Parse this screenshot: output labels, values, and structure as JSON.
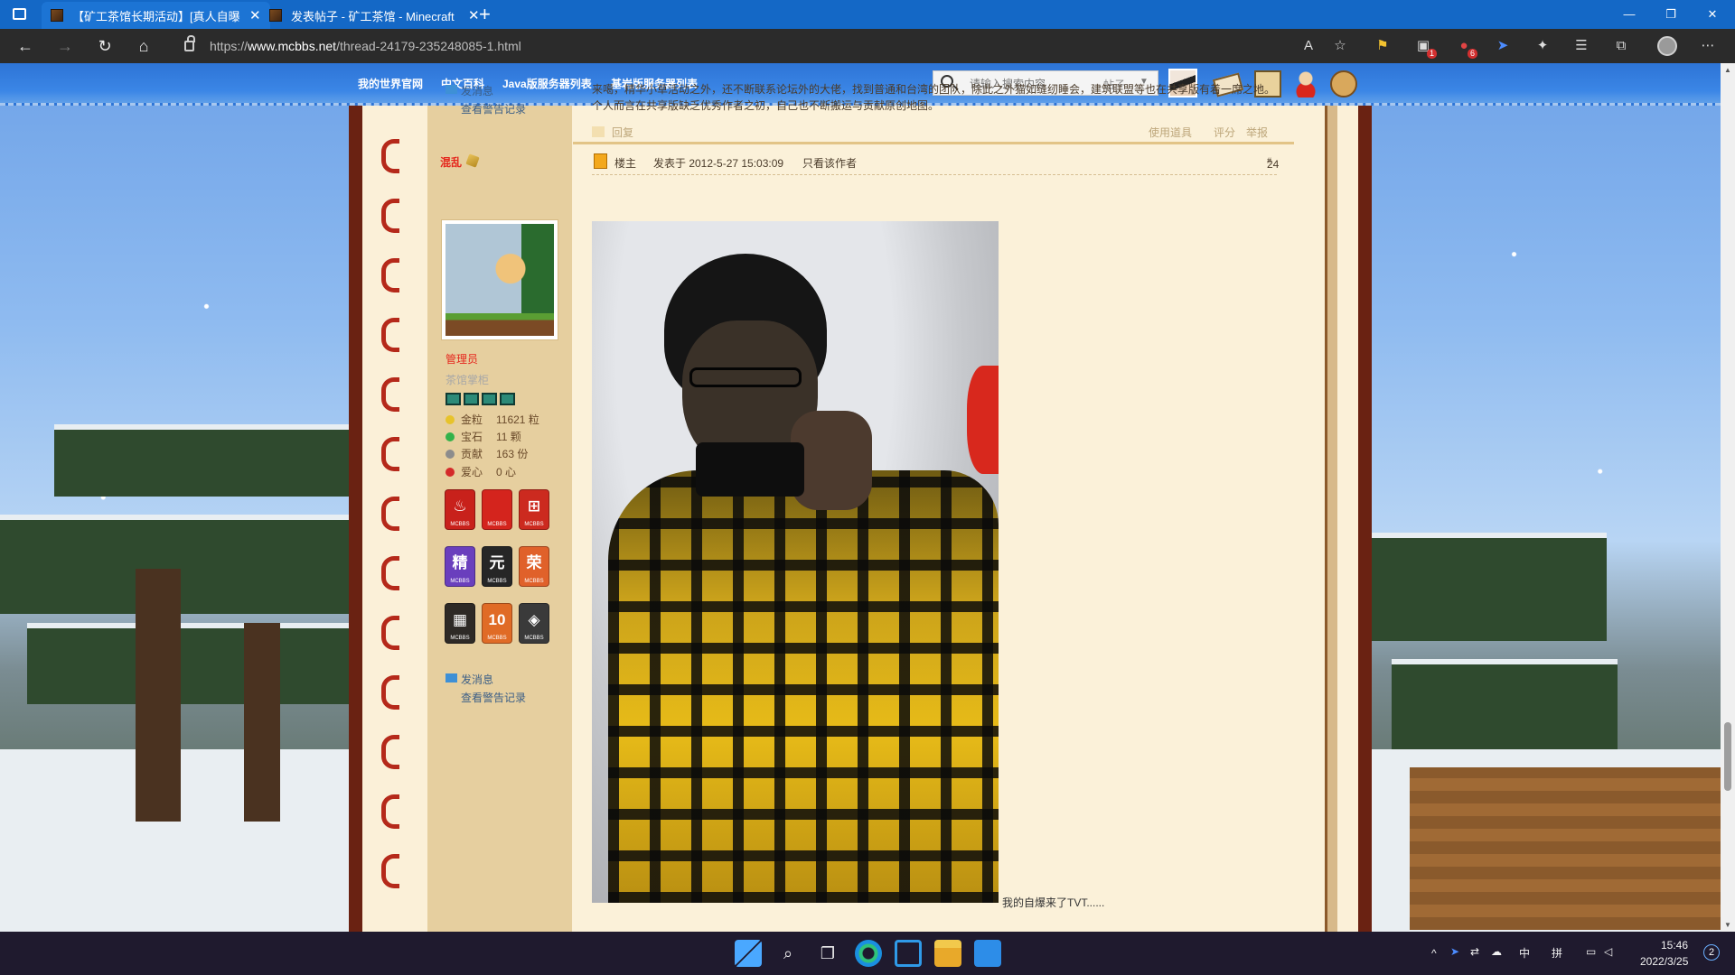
{
  "browser": {
    "tabs": [
      {
        "label": "【矿工茶馆长期活动】[真人自曝"
      },
      {
        "label": "发表帖子 - 矿工茶馆 - Minecraft"
      }
    ],
    "url": {
      "prefix": "https://",
      "host": "www.mcbbs.net",
      "path": "/thread-24179-235248085-1.html"
    },
    "extension_badges": {
      "first": "1",
      "second": "6"
    }
  },
  "site_nav": {
    "links": [
      "我的世界官网",
      "中文百科",
      "Java版服务器列表",
      "基岩版服务器列表"
    ],
    "search": {
      "placeholder": "请输入搜索内容",
      "scope": "帖子"
    }
  },
  "previous_post": {
    "line1": "来噶，精华小草活动之外，还不断联系论坛外的大佬，找到普通和台湾的团队，除此之外猫如缝纫睡会，建筑联盟等也在共享版有着一席之地。",
    "line2": "个人而言在共享版缺乏优秀作者之初，自己也不断搬运与贡献原创地图。",
    "actions": {
      "reply": "回复",
      "use_tool": "使用道具",
      "rate": "评分",
      "report": "举报"
    }
  },
  "prev_author_links": {
    "message": "发消息",
    "warnings": "查看警告记录"
  },
  "author": {
    "name": "混乱",
    "role": "管理员",
    "subrole": "茶馆掌柜",
    "stats": [
      {
        "key": "金粒",
        "value": "11621 粒",
        "color": "#e7c32b"
      },
      {
        "key": "宝石",
        "value": "11 颗",
        "color": "#33b24a"
      },
      {
        "key": "贡献",
        "value": "163 份",
        "color": "#8c8c8c"
      },
      {
        "key": "爱心",
        "value": "0 心",
        "color": "#d42a2a"
      }
    ],
    "medals": [
      {
        "glyph": "♨",
        "label": "MCBBS",
        "color": "#c8211b"
      },
      {
        "glyph": "",
        "label": "MCBBS",
        "color": "#d4241d"
      },
      {
        "glyph": "⊞",
        "label": "MCBBS",
        "color": "#cc2a1f"
      },
      {
        "glyph": "精",
        "label": "MCBBS",
        "color": "#6a3fbd"
      },
      {
        "glyph": "元",
        "label": "MCBBS",
        "color": "#262626"
      },
      {
        "glyph": "荣",
        "label": "MCBBS",
        "color": "#e0612a"
      },
      {
        "glyph": "▦",
        "label": "MCBBS",
        "color": "#2e2a26"
      },
      {
        "glyph": "10",
        "label": "MCBBS",
        "color": "#e06b26"
      },
      {
        "glyph": "◈",
        "label": "MCBBS",
        "color": "#3a3a3a"
      }
    ],
    "links": {
      "message": "发消息",
      "warnings": "查看警告记录"
    }
  },
  "post": {
    "owner_tag": "楼主",
    "posted": "发表于 2012-5-27 15:03:09",
    "only_author": "只看该作者",
    "floor": "24",
    "floor_suffix": "#",
    "caption": "我的自爆来了TVT......"
  },
  "taskbar": {
    "tray_ime": "中",
    "tray_ime2": "拼",
    "time": "15:46",
    "date": "2022/3/25",
    "notifications": "2"
  },
  "colors": {
    "tab_strip": "#1468c6",
    "nav": "#2d74d6",
    "frame": "#6a2212",
    "accent_red": "#e5261c"
  }
}
